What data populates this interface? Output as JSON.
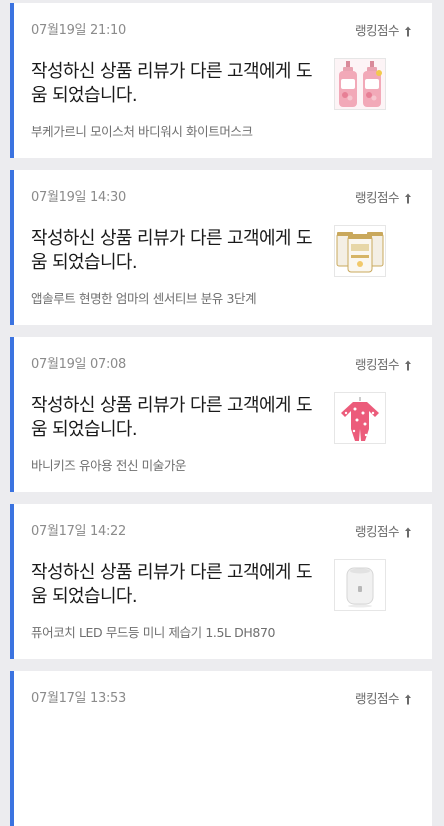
{
  "notifications": [
    {
      "date": "07월19일 21:10",
      "rank_label": "랭킹점수",
      "rank_icon": "arrow-up-icon",
      "message": "작성하신 상품 리뷰가 다른 고객에게 도움 되었습니다.",
      "product": "부케가르니 모이스처 바디워시 화이트머스크",
      "thumb_icon": "bodywash-bottles-thumbnail"
    },
    {
      "date": "07월19일 14:30",
      "rank_label": "랭킹점수",
      "rank_icon": "arrow-up-icon",
      "message": "작성하신 상품 리뷰가 다른 고객에게 도움 되었습니다.",
      "product": "앱솔루트 현명한 엄마의 센서티브 분유 3단계",
      "thumb_icon": "formula-cans-thumbnail"
    },
    {
      "date": "07월19일 07:08",
      "rank_label": "랭킹점수",
      "rank_icon": "arrow-up-icon",
      "message": "작성하신 상품 리뷰가 다른 고객에게 도움 되었습니다.",
      "product": "바니키즈 유아용 전신 미술가운",
      "thumb_icon": "kids-art-gown-thumbnail"
    },
    {
      "date": "07월17일 14:22",
      "rank_label": "랭킹점수",
      "rank_icon": "arrow-up-icon",
      "message": "작성하신 상품 리뷰가 다른 고객에게 도움 되었습니다.",
      "product": "퓨어코치 LED 무드등 미니 제습기 1.5L DH870",
      "thumb_icon": "dehumidifier-thumbnail"
    },
    {
      "date": "07월17일 13:53",
      "rank_label": "랭킹점수",
      "rank_icon": "arrow-up-icon",
      "message": "",
      "product": "",
      "thumb_icon": ""
    }
  ],
  "colors": {
    "accent": "#3b73e0",
    "background": "#ececef",
    "card": "#ffffff"
  }
}
